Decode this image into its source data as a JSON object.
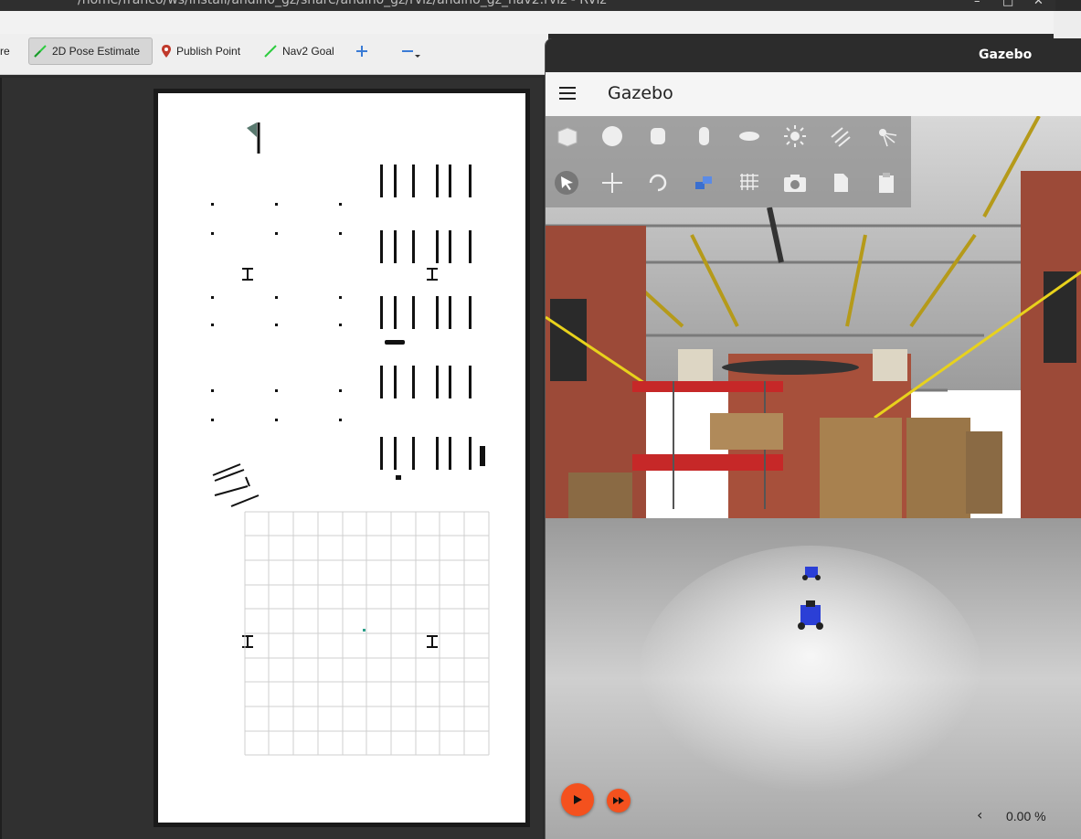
{
  "rviz": {
    "window_title": "/home/franco/ws/install/andino_gz/share/andino_gz/rviz/andino_gz_nav2.rviz - RViz",
    "toolbar": {
      "partial_label": "re",
      "pose_estimate_label": "2D Pose Estimate",
      "publish_point_label": "Publish Point",
      "nav2_goal_label": "Nav2 Goal"
    }
  },
  "gazebo": {
    "window_title": "Gazebo",
    "app_title": "Gazebo",
    "real_time_factor": "0.00 %",
    "toolbar_icons": [
      "box-icon",
      "sphere-icon",
      "cylinder-icon",
      "capsule-icon",
      "ellipsoid-icon",
      "sun-light-icon",
      "directional-light-icon",
      "point-light-icon",
      "select-icon",
      "translate-icon",
      "rotate-icon",
      "snap-icon",
      "grid-icon",
      "screenshot-icon",
      "copy-icon",
      "paste-icon"
    ]
  },
  "colors": {
    "accent_orange": "#f4511e",
    "nav_green": "#2ecc40",
    "pin_red": "#c0392b"
  }
}
